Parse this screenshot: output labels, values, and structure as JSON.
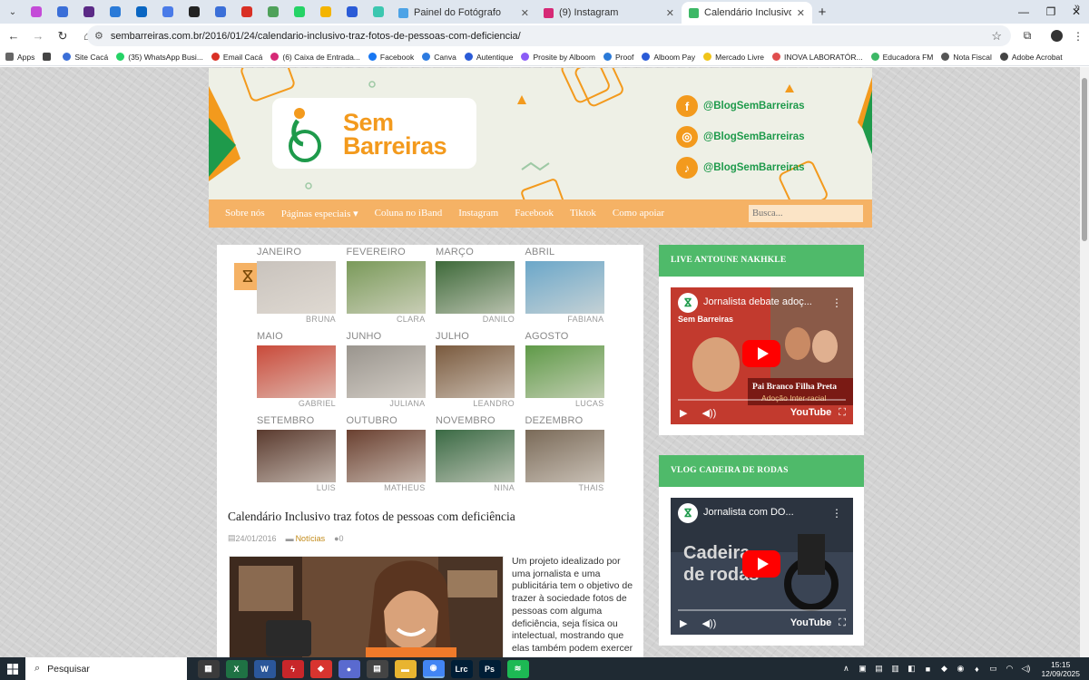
{
  "browser": {
    "pinned_tabs": [
      {
        "icon": "mail-icon",
        "color": "#c44bd8"
      },
      {
        "icon": "colorful-logo-icon",
        "color": "#3b6fd8"
      },
      {
        "icon": "app-icon",
        "color": "#5b2a86"
      },
      {
        "icon": "u-logo-icon",
        "color": "#2a7ad8"
      },
      {
        "icon": "linkedin-icon",
        "color": "#0a66c2"
      },
      {
        "icon": "docs-icon",
        "color": "#4a7be8"
      },
      {
        "icon": "threads-icon",
        "color": "#222222"
      },
      {
        "icon": "colorful-logo-icon",
        "color": "#3b6fd8"
      },
      {
        "icon": "gmail-icon",
        "color": "#d93025"
      },
      {
        "icon": "sheet-icon",
        "color": "#4fa15a"
      },
      {
        "icon": "whatsapp-icon",
        "color": "#25d366"
      },
      {
        "icon": "drive-icon",
        "color": "#f4b400"
      },
      {
        "icon": "app-icon",
        "color": "#2a5bd7"
      },
      {
        "icon": "app-icon",
        "color": "#3cc7b0"
      }
    ],
    "tabs": [
      {
        "title": "Painel do Fotógrafo",
        "fav_color": "#4da3e6",
        "active": false
      },
      {
        "title": "(9) Instagram",
        "fav_color": "#d62976",
        "active": false
      },
      {
        "title": "Calendário Inclusivo traz fotos c",
        "fav_color": "#3db866",
        "active": true
      }
    ],
    "url": "sembarreiras.com.br/2016/01/24/calendario-inclusivo-traz-fotos-de-pessoas-com-deficiencia/",
    "bookmarks": [
      {
        "label": "Apps",
        "color": "#666666"
      },
      {
        "label": "",
        "color": "#444444"
      },
      {
        "label": "Site Cacá",
        "color": "#3b6fd8"
      },
      {
        "label": "(35) WhatsApp Busi...",
        "color": "#25d366"
      },
      {
        "label": "Email Cacá",
        "color": "#d93025"
      },
      {
        "label": "(6) Caixa de Entrada...",
        "color": "#d62976"
      },
      {
        "label": "Facebook",
        "color": "#1877f2"
      },
      {
        "label": "Canva",
        "color": "#2d7be0"
      },
      {
        "label": "Autentique",
        "color": "#2a5bd7"
      },
      {
        "label": "Prosite by Alboom",
        "color": "#8b5cf6"
      },
      {
        "label": "Proof",
        "color": "#2a7ad8"
      },
      {
        "label": "Alboom Pay",
        "color": "#2a5bd7"
      },
      {
        "label": "Mercado Livre",
        "color": "#f0c419"
      },
      {
        "label": "INOVA LABORATÓR...",
        "color": "#e04e4e"
      },
      {
        "label": "Educadora FM",
        "color": "#3db866"
      },
      {
        "label": "Nota Fiscal",
        "color": "#555555"
      },
      {
        "label": "Adobe Acrobat",
        "color": "#444444"
      }
    ]
  },
  "header": {
    "logo_line1": "Sem",
    "logo_line2": "Barreiras",
    "socials": [
      {
        "icon": "facebook-icon",
        "glyph": "f",
        "handle": "@BlogSemBarreiras"
      },
      {
        "icon": "instagram-icon",
        "glyph": "◎",
        "handle": "@BlogSemBarreiras"
      },
      {
        "icon": "tiktok-icon",
        "glyph": "♪",
        "handle": "@BlogSemBarreiras"
      }
    ]
  },
  "nav": {
    "items": [
      "Sobre nós",
      "Páginas especiais ▾",
      "Coluna no iBand",
      "Instagram",
      "Facebook",
      "Tiktok",
      "Como apoiar"
    ],
    "search_placeholder": "Busca..."
  },
  "calendar": {
    "months": [
      {
        "month": "JANEIRO",
        "name": "BRUNA",
        "color": "#c9c3bd"
      },
      {
        "month": "FEVEREIRO",
        "name": "CLARA",
        "color": "#7a9a5a"
      },
      {
        "month": "MARÇO",
        "name": "DANILO",
        "color": "#3e6a3a"
      },
      {
        "month": "ABRIL",
        "name": "FABIANA",
        "color": "#6ba7c9"
      },
      {
        "month": "MAIO",
        "name": "GABRIEL",
        "color": "#c94a3a"
      },
      {
        "month": "JUNHO",
        "name": "JULIANA",
        "color": "#9a958e"
      },
      {
        "month": "JULHO",
        "name": "LEANDRO",
        "color": "#7a5a3e"
      },
      {
        "month": "AGOSTO",
        "name": "LUCAS",
        "color": "#5f9a48"
      },
      {
        "month": "SETEMBRO",
        "name": "LUIS",
        "color": "#5a3a2e"
      },
      {
        "month": "OUTUBRO",
        "name": "MATHEUS",
        "color": "#6a4030"
      },
      {
        "month": "NOVEMBRO",
        "name": "NINA",
        "color": "#3a6a44"
      },
      {
        "month": "DEZEMBRO",
        "name": "THAIS",
        "color": "#7a6a58"
      }
    ]
  },
  "post": {
    "title": "Calendário Inclusivo traz fotos de pessoas com deficiência",
    "date": "24/01/2016",
    "category": "Notícias",
    "comments": "0",
    "excerpt": "Um projeto idealizado por uma jornalista e uma publicitária tem o objetivo de trazer à sociedade fotos de pessoas com alguma deficiência, seja física ou intelectual, mostrando que elas também podem exercer"
  },
  "sidebar": {
    "widgets": [
      {
        "heading": "LIVE ANTOUNE NAKHKLE",
        "video_title": "Jornalista debate adoç...",
        "overlay_1": "Sem Barreiras",
        "overlay_2": "Pai Branco Filha Preta",
        "overlay_3": "Adoção Inter-racial"
      },
      {
        "heading": "VLOG CADEIRA DE RODAS",
        "video_title": "Jornalista com DO...",
        "overlay_1": "Cadeira",
        "overlay_2": "de rodas",
        "overlay_3": ""
      }
    ],
    "youtube_label": "YouTube"
  },
  "taskbar": {
    "search_label": "Pesquisar",
    "apps": [
      {
        "icon": "calendar-app-icon",
        "glyph": "▦",
        "color": "#3b3b3b"
      },
      {
        "icon": "excel-icon",
        "glyph": "X",
        "color": "#1f7244"
      },
      {
        "icon": "word-icon",
        "glyph": "W",
        "color": "#2b579a"
      },
      {
        "icon": "flash-app-icon",
        "glyph": "ϟ",
        "color": "#c8262a"
      },
      {
        "icon": "red-app-icon",
        "glyph": "◆",
        "color": "#d8342f"
      },
      {
        "icon": "vpn-app-icon",
        "glyph": "●",
        "color": "#5a6acf"
      },
      {
        "icon": "calculator-icon",
        "glyph": "▤",
        "color": "#444444"
      },
      {
        "icon": "file-explorer-icon",
        "glyph": "▬",
        "color": "#e8b430"
      },
      {
        "icon": "chrome-icon",
        "glyph": "◉",
        "color": "#4285f4"
      },
      {
        "icon": "lightroom-icon",
        "glyph": "Lrc",
        "color": "#001e36"
      },
      {
        "icon": "photoshop-icon",
        "glyph": "Ps",
        "color": "#001e36"
      },
      {
        "icon": "spotify-icon",
        "glyph": "≋",
        "color": "#1db954"
      }
    ],
    "time": "15:15",
    "date": "12/09/2025"
  }
}
